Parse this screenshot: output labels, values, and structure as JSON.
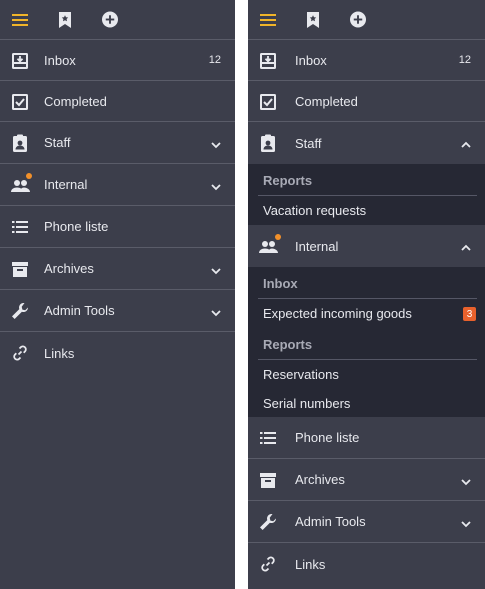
{
  "colors": {
    "panel_bg": "#3c3e4b",
    "sub_bg": "#262834",
    "accent": "#f0b429",
    "badge": "#e8612c",
    "dot": "#f2902a"
  },
  "left": {
    "items": [
      {
        "label": "Inbox",
        "count": "12",
        "icon": "inbox-icon"
      },
      {
        "label": "Completed",
        "icon": "checkbox-icon"
      },
      {
        "label": "Staff",
        "icon": "clipboard-badge-icon"
      },
      {
        "label": "Internal",
        "icon": "people-icon"
      },
      {
        "label": "Phone liste",
        "icon": "list-icon"
      },
      {
        "label": "Archives",
        "icon": "archive-icon"
      },
      {
        "label": "Admin Tools",
        "icon": "wrench-icon"
      },
      {
        "label": "Links",
        "icon": "link-icon"
      }
    ]
  },
  "right": {
    "items": [
      {
        "label": "Inbox",
        "count": "12"
      },
      {
        "label": "Completed"
      },
      {
        "label": "Staff"
      },
      {
        "label": "Internal"
      },
      {
        "label": "Phone liste"
      },
      {
        "label": "Archives"
      },
      {
        "label": "Admin Tools"
      },
      {
        "label": "Links"
      }
    ],
    "staff_sub": {
      "heading": "Reports",
      "items": [
        "Vacation requests"
      ]
    },
    "internal_sub": {
      "inbox_heading": "Inbox",
      "inbox_items": [
        {
          "label": "Expected incoming goods",
          "badge": "3"
        }
      ],
      "reports_heading": "Reports",
      "reports_items": [
        "Reservations",
        "Serial numbers"
      ]
    }
  }
}
